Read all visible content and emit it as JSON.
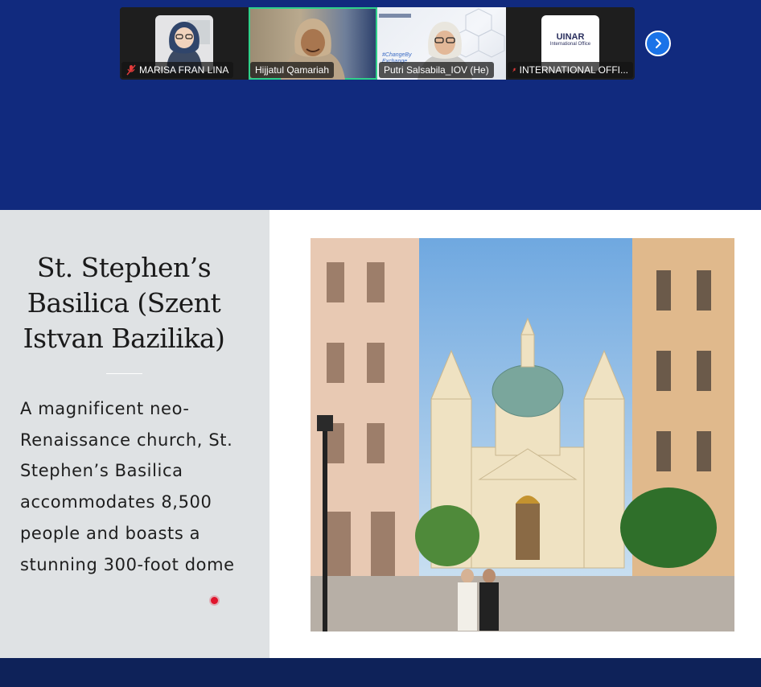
{
  "meeting": {
    "participants": [
      {
        "name": "MARISA FRAN LINA",
        "muted": true,
        "active": false
      },
      {
        "name": "Hijjatul Qamariah",
        "muted": false,
        "active": true
      },
      {
        "name": "Putri Salsabila_IOV (He)",
        "muted": false,
        "active": false
      },
      {
        "name": "INTERNATIONAL OFFI...",
        "muted": true,
        "active": false,
        "logo_text": "UINAR",
        "logo_sub": "International Office"
      }
    ],
    "background_text": "#ChangeBy Exchange",
    "next_icon": "chevron-right-icon"
  },
  "slide": {
    "title": "St. Stephen’s Basilica (Szent Istvan Bazilika)",
    "body": "A magnificent neo-Renaissance church, St. Stephen’s Basilica accommodates 8,500 people and boasts a stunning 300-foot dome",
    "image_subject": "basilica-photo"
  },
  "colors": {
    "top_band": "#112a7e",
    "bottom_band": "#0e2259",
    "left_panel": "#dfe2e4",
    "active_speaker": "#2fd08a",
    "pointer": "#e0142c"
  }
}
